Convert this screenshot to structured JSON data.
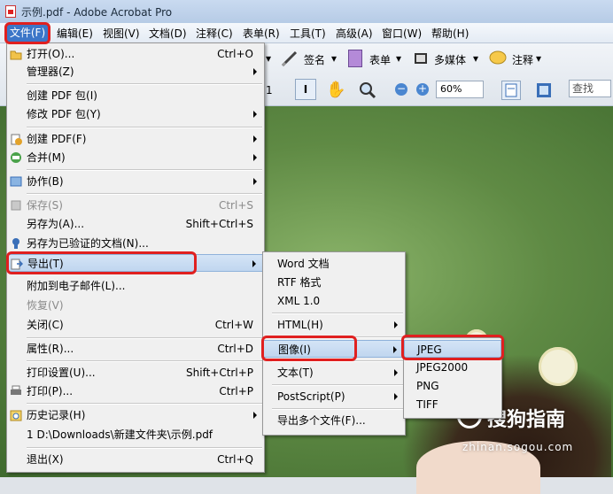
{
  "window": {
    "title": "示例.pdf - Adobe Acrobat Pro"
  },
  "menubar": {
    "file": "文件(F)",
    "items": [
      "编辑(E)",
      "视图(V)",
      "文档(D)",
      "注释(C)",
      "表单(R)",
      "工具(T)",
      "高级(A)",
      "窗口(W)",
      "帮助(H)"
    ]
  },
  "toolbar": {
    "sign": "签名",
    "form": "表单",
    "multimedia": "多媒体",
    "comment": "注释",
    "page": "1",
    "zoom": "60%",
    "search_placeholder": "查找"
  },
  "file_menu": [
    {
      "label": "打开(O)...",
      "shortcut": "Ctrl+O",
      "icon": "open-folder-icon"
    },
    {
      "label": "管理器(Z)",
      "submenu": true
    },
    {
      "label": "创建 PDF 包(I)"
    },
    {
      "label": "修改 PDF 包(Y)",
      "submenu": true
    },
    {
      "label": "创建 PDF(F)",
      "submenu": true,
      "icon": "create-pdf-icon"
    },
    {
      "label": "合并(M)",
      "submenu": true,
      "icon": "combine-icon"
    },
    {
      "label": "协作(B)",
      "submenu": true,
      "icon": "collaborate-icon"
    },
    {
      "label": "保存(S)",
      "shortcut": "Ctrl+S",
      "disabled": true,
      "icon": "save-icon"
    },
    {
      "label": "另存为(A)...",
      "shortcut": "Shift+Ctrl+S"
    },
    {
      "label": "另存为已验证的文档(N)...",
      "icon": "certified-icon"
    },
    {
      "label": "导出(T)",
      "submenu": true,
      "icon": "export-icon",
      "highlighted": true
    },
    {
      "label": "附加到电子邮件(L)..."
    },
    {
      "label": "恢复(V)",
      "disabled": true
    },
    {
      "label": "关闭(C)",
      "shortcut": "Ctrl+W"
    },
    {
      "label": "属性(R)...",
      "shortcut": "Ctrl+D"
    },
    {
      "label": "打印设置(U)...",
      "shortcut": "Shift+Ctrl+P"
    },
    {
      "label": "打印(P)...",
      "shortcut": "Ctrl+P",
      "icon": "print-icon"
    },
    {
      "label": "历史记录(H)",
      "submenu": true,
      "icon": "history-icon"
    },
    {
      "label": "1 D:\\Downloads\\新建文件夹\\示例.pdf"
    },
    {
      "label": "退出(X)",
      "shortcut": "Ctrl+Q"
    }
  ],
  "export_menu": [
    {
      "label": "Word 文档"
    },
    {
      "label": "RTF 格式"
    },
    {
      "label": "XML 1.0"
    },
    {
      "label": "HTML(H)",
      "submenu": true
    },
    {
      "label": "图像(I)",
      "submenu": true,
      "highlighted": true
    },
    {
      "label": "文本(T)",
      "submenu": true
    },
    {
      "label": "PostScript(P)",
      "submenu": true
    },
    {
      "label": "导出多个文件(F)..."
    }
  ],
  "image_menu": [
    {
      "label": "JPEG",
      "highlighted": true
    },
    {
      "label": "JPEG2000"
    },
    {
      "label": "PNG"
    },
    {
      "label": "TIFF"
    }
  ],
  "watermark": {
    "text": "搜狗指南",
    "url": "zhinan.sogou.com"
  },
  "colors": {
    "highlight": "#c0d6ef",
    "annotation": "#e02020",
    "menubar_active": "#3c76c8"
  }
}
